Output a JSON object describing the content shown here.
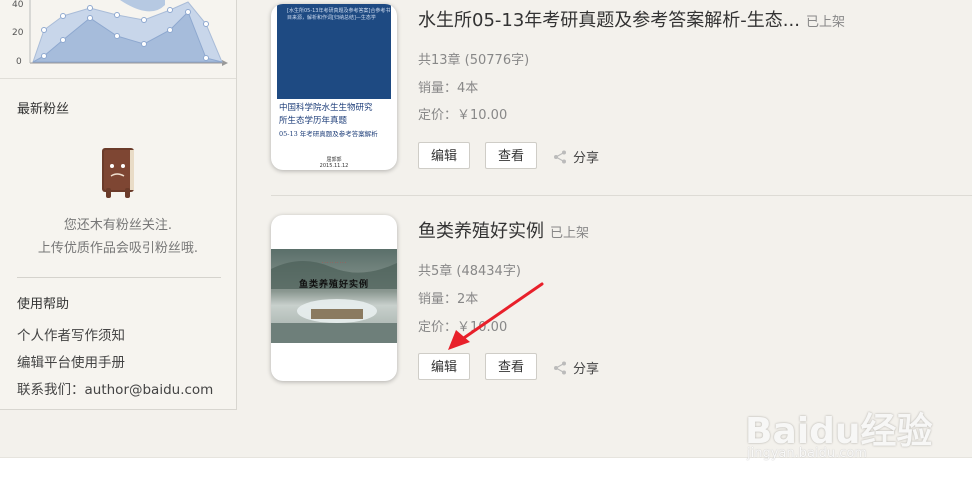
{
  "sidebar": {
    "chart_ticks": [
      "40",
      "20",
      "0"
    ],
    "fans_title": "最新粉丝",
    "fans_empty_line1": "您还木有粉丝关注.",
    "fans_empty_line2": "上传优质作品会吸引粉丝哦.",
    "help_title": "使用帮助",
    "help_links": [
      "个人作者写作须知",
      "编辑平台使用手册",
      "联系我们：author@baidu.com"
    ]
  },
  "books": [
    {
      "title": "水生所05-13年考研真题及参考答案解析-生态...",
      "status": "已上架",
      "chapters": "共13章 (50776字)",
      "sales": "销量：4本",
      "price": "定价：￥10.00",
      "edit_label": "编辑",
      "view_label": "查看",
      "share_label": "分享",
      "cover": {
        "top_text": "[水生所05-13年考研真题及参考答案]合参考书目来源，解析和作词[归纳总结]—生态学",
        "title_line1": "中国科学院水生生物研究",
        "title_line2": "所生态学历年真题",
        "title_line3": "05-13 年考研真题及参考答案解析",
        "author": "屈郭郭",
        "date": "2015.11.12"
      }
    },
    {
      "title": "鱼类养殖好实例",
      "status": "已上架",
      "chapters": "共5章 (48434字)",
      "sales": "销量：2本",
      "price": "定价：￥10.00",
      "edit_label": "编辑",
      "view_label": "查看",
      "share_label": "分享",
      "cover": {
        "title": "鱼类养殖好实例"
      }
    }
  ],
  "watermark": {
    "brand": "Baidu经验",
    "url": "jingyan.baidu.com"
  }
}
